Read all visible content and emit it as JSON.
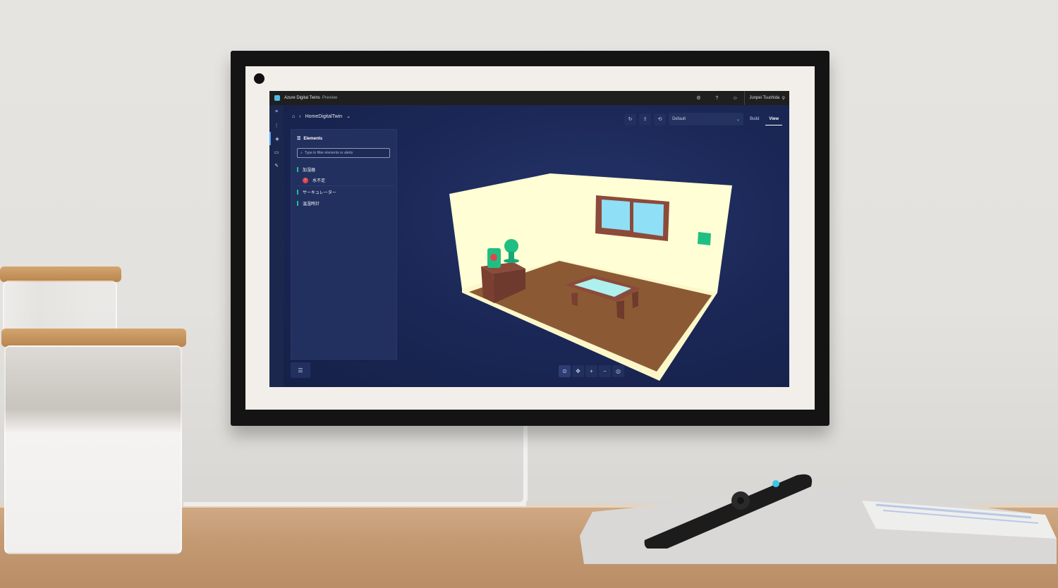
{
  "app": {
    "title": "Azure Digital Twins",
    "subtitle": "Preview",
    "user": "Junpei Tsuchida",
    "icons": [
      "gear-icon",
      "help-icon",
      "feedback-icon",
      "user-icon"
    ]
  },
  "breadcrumb": {
    "home_icon": "home-icon",
    "twin": "HomeDigitalTwin"
  },
  "toolbar": {
    "scene_select": "Default",
    "build_label": "Build",
    "view_label": "View",
    "active_mode": "View"
  },
  "elements_panel": {
    "title": "Elements",
    "filter_placeholder": "Type to filter elements or alerts",
    "items": [
      {
        "label": "加湿器"
      },
      {
        "label": "水不足",
        "type": "alert"
      },
      {
        "label": "サーキュレーター"
      },
      {
        "label": "温湿時計"
      }
    ]
  },
  "colors": {
    "accent": "#4da3ff",
    "status_green": "#1fc28a",
    "alert_red": "#e04848",
    "background": "#1b2a57"
  }
}
